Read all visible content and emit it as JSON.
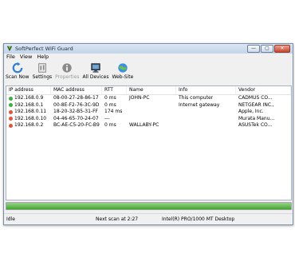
{
  "window": {
    "title": "SoftPerfect WiFi Guard",
    "controls": {
      "minimize": "—",
      "maximize": "▢",
      "close": "✕"
    }
  },
  "menu": [
    "File",
    "View",
    "Help"
  ],
  "toolbar": [
    {
      "label": "Scan Now",
      "icon": "refresh-icon",
      "enabled": true
    },
    {
      "label": "Settings",
      "icon": "settings-icon",
      "enabled": true
    },
    {
      "label": "Properties",
      "icon": "info-icon",
      "enabled": false
    },
    {
      "label": "All Devices",
      "icon": "devices-icon",
      "enabled": true
    },
    {
      "label": "Web-Site",
      "icon": "globe-icon",
      "enabled": true
    }
  ],
  "table": {
    "columns": [
      "IP address",
      "MAC address",
      "RTT",
      "Name",
      "Info",
      "Vendor"
    ],
    "rows": [
      {
        "status": "green",
        "ip": "192.168.0.9",
        "mac": "08-00-27-28-86-17",
        "rtt": "0 ms",
        "name": "JOHN-PC",
        "info": "This computer",
        "vendor": "CADMUS CO..."
      },
      {
        "status": "green",
        "ip": "192.168.0.1",
        "mac": "00-8E-F2-76-3C-9D",
        "rtt": "0 ms",
        "name": "",
        "info": "Internet gateway",
        "vendor": "NETGEAR INC.,"
      },
      {
        "status": "red",
        "ip": "192.168.0.11",
        "mac": "18-20-32-B5-31-FF",
        "rtt": "174 ms",
        "name": "",
        "info": "",
        "vendor": "Apple, Inc."
      },
      {
        "status": "red",
        "ip": "192.168.0.10",
        "mac": "04-46-65-70-24-07",
        "rtt": "---",
        "name": "",
        "info": "",
        "vendor": "Murata Manu..."
      },
      {
        "status": "red",
        "ip": "192.168.0.2",
        "mac": "BC-AE-C5-20-FC-B9",
        "rtt": "0 ms",
        "name": "WALLABY-PC",
        "info": "",
        "vendor": "ASUSTek CO..."
      }
    ]
  },
  "progress": {
    "value": 1.0
  },
  "status": {
    "state": "Idle",
    "next_scan": "Next scan at 2:27",
    "adapter": "Intel(R) PRO/1000 MT Desktop"
  },
  "colors": {
    "green": "#3cb043",
    "red": "#e0553a",
    "accent": "#2b7bd4"
  }
}
